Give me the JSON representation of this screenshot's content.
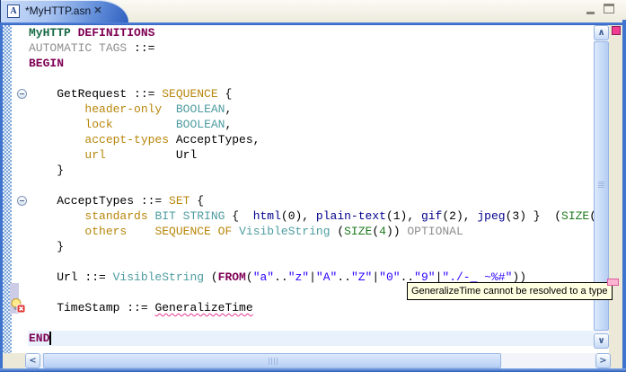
{
  "tab": {
    "title": "*MyHTTP.asn",
    "file_icon_letter": "A",
    "close_glyph": "✕"
  },
  "view_controls": {
    "minimize_label": "Minimize",
    "maximize_label": "Maximize"
  },
  "tooltip": {
    "text": "GeneralizeTime cannot be resolved to a type"
  },
  "scrollbars": {
    "up_glyph": "∧",
    "down_glyph": "∨",
    "left_glyph": "<",
    "right_glyph": ">"
  },
  "colors": {
    "frame_blue": "#3E74CE",
    "tab_bar_bg": "#EDEBDD",
    "current_line": "#E9F2FC",
    "keyword": "#7F0055",
    "module_name": "#186A46",
    "muted_gray": "#8E8E8E",
    "field_gold": "#B8860B",
    "type_teal": "#4E9CA0",
    "enum_navy": "#00008B",
    "size_green": "#1F7A1F",
    "string_blue": "#2A00FF",
    "error_squiggle": "#E8368F",
    "overview_marker_pink": "#F13C92"
  },
  "editor": {
    "language": "ASN.1",
    "fold_rows": [
      5,
      12
    ],
    "cursor_row": 21,
    "current_line_row": 21,
    "error_row": 19,
    "lines": [
      {
        "segments": [
          {
            "t": "MyHTTP",
            "s": "module"
          },
          {
            "t": " "
          },
          {
            "t": "DEFINITIONS",
            "s": "kw"
          }
        ]
      },
      {
        "segments": [
          {
            "t": "AUTOMATIC TAGS",
            "s": "dim"
          },
          {
            "t": " ::="
          }
        ]
      },
      {
        "segments": [
          {
            "t": "BEGIN",
            "s": "kw"
          }
        ]
      },
      {
        "segments": []
      },
      {
        "segments": [
          {
            "t": "    GetRequest ::= "
          },
          {
            "t": "SEQUENCE",
            "s": "gold"
          },
          {
            "t": " {"
          }
        ]
      },
      {
        "segments": [
          {
            "t": "        "
          },
          {
            "t": "header-only",
            "s": "gold"
          },
          {
            "t": "  "
          },
          {
            "t": "BOOLEAN",
            "s": "type"
          },
          {
            "t": ","
          }
        ]
      },
      {
        "segments": [
          {
            "t": "        "
          },
          {
            "t": "lock",
            "s": "gold"
          },
          {
            "t": "         "
          },
          {
            "t": "BOOLEAN",
            "s": "type"
          },
          {
            "t": ","
          }
        ]
      },
      {
        "segments": [
          {
            "t": "        "
          },
          {
            "t": "accept-types",
            "s": "gold"
          },
          {
            "t": " AcceptTypes,"
          }
        ]
      },
      {
        "segments": [
          {
            "t": "        "
          },
          {
            "t": "url",
            "s": "gold"
          },
          {
            "t": "          Url"
          }
        ]
      },
      {
        "segments": [
          {
            "t": "    }"
          }
        ]
      },
      {
        "segments": []
      },
      {
        "segments": [
          {
            "t": "    AcceptTypes ::= "
          },
          {
            "t": "SET",
            "s": "gold"
          },
          {
            "t": " {"
          }
        ]
      },
      {
        "segments": [
          {
            "t": "        "
          },
          {
            "t": "standards",
            "s": "gold"
          },
          {
            "t": " "
          },
          {
            "t": "BIT STRING",
            "s": "type"
          },
          {
            "t": " {  "
          },
          {
            "t": "html",
            "s": "enum"
          },
          {
            "t": "(0), "
          },
          {
            "t": "plain-text",
            "s": "enum"
          },
          {
            "t": "(1), "
          },
          {
            "t": "gif",
            "s": "enum"
          },
          {
            "t": "(2), "
          },
          {
            "t": "jpeg",
            "s": "enum"
          },
          {
            "t": "(3) }  ("
          },
          {
            "t": "SIZE",
            "s": "size"
          },
          {
            "t": "("
          }
        ]
      },
      {
        "segments": [
          {
            "t": "        "
          },
          {
            "t": "others",
            "s": "gold"
          },
          {
            "t": "    "
          },
          {
            "t": "SEQUENCE OF",
            "s": "gold"
          },
          {
            "t": " "
          },
          {
            "t": "VisibleString",
            "s": "type"
          },
          {
            "t": " ("
          },
          {
            "t": "SIZE",
            "s": "size"
          },
          {
            "t": "("
          },
          {
            "t": "4",
            "s": "size"
          },
          {
            "t": ")) "
          },
          {
            "t": "OPTIONAL",
            "s": "dim"
          }
        ]
      },
      {
        "segments": [
          {
            "t": "    }"
          }
        ]
      },
      {
        "segments": []
      },
      {
        "segments": [
          {
            "t": "    Url ::= "
          },
          {
            "t": "VisibleString",
            "s": "type"
          },
          {
            "t": " ("
          },
          {
            "t": "FROM",
            "s": "kw"
          },
          {
            "t": "("
          },
          {
            "t": "\"a\"",
            "s": "str"
          },
          {
            "t": ".."
          },
          {
            "t": "\"z\"",
            "s": "str"
          },
          {
            "t": "|"
          },
          {
            "t": "\"A\"",
            "s": "str"
          },
          {
            "t": ".."
          },
          {
            "t": "\"Z\"",
            "s": "str"
          },
          {
            "t": "|"
          },
          {
            "t": "\"0\"",
            "s": "str"
          },
          {
            "t": ".."
          },
          {
            "t": "\"9\"",
            "s": "str"
          },
          {
            "t": "|"
          },
          {
            "t": "\"./-_ ~%#\"",
            "s": "str"
          },
          {
            "t": "))"
          }
        ]
      },
      {
        "segments": []
      },
      {
        "segments": [
          {
            "t": "    TimeStamp ::= "
          },
          {
            "t": "GeneralizeTime",
            "s": "err"
          }
        ]
      },
      {
        "segments": []
      },
      {
        "segments": [
          {
            "t": "END",
            "s": "kw"
          }
        ]
      }
    ]
  }
}
